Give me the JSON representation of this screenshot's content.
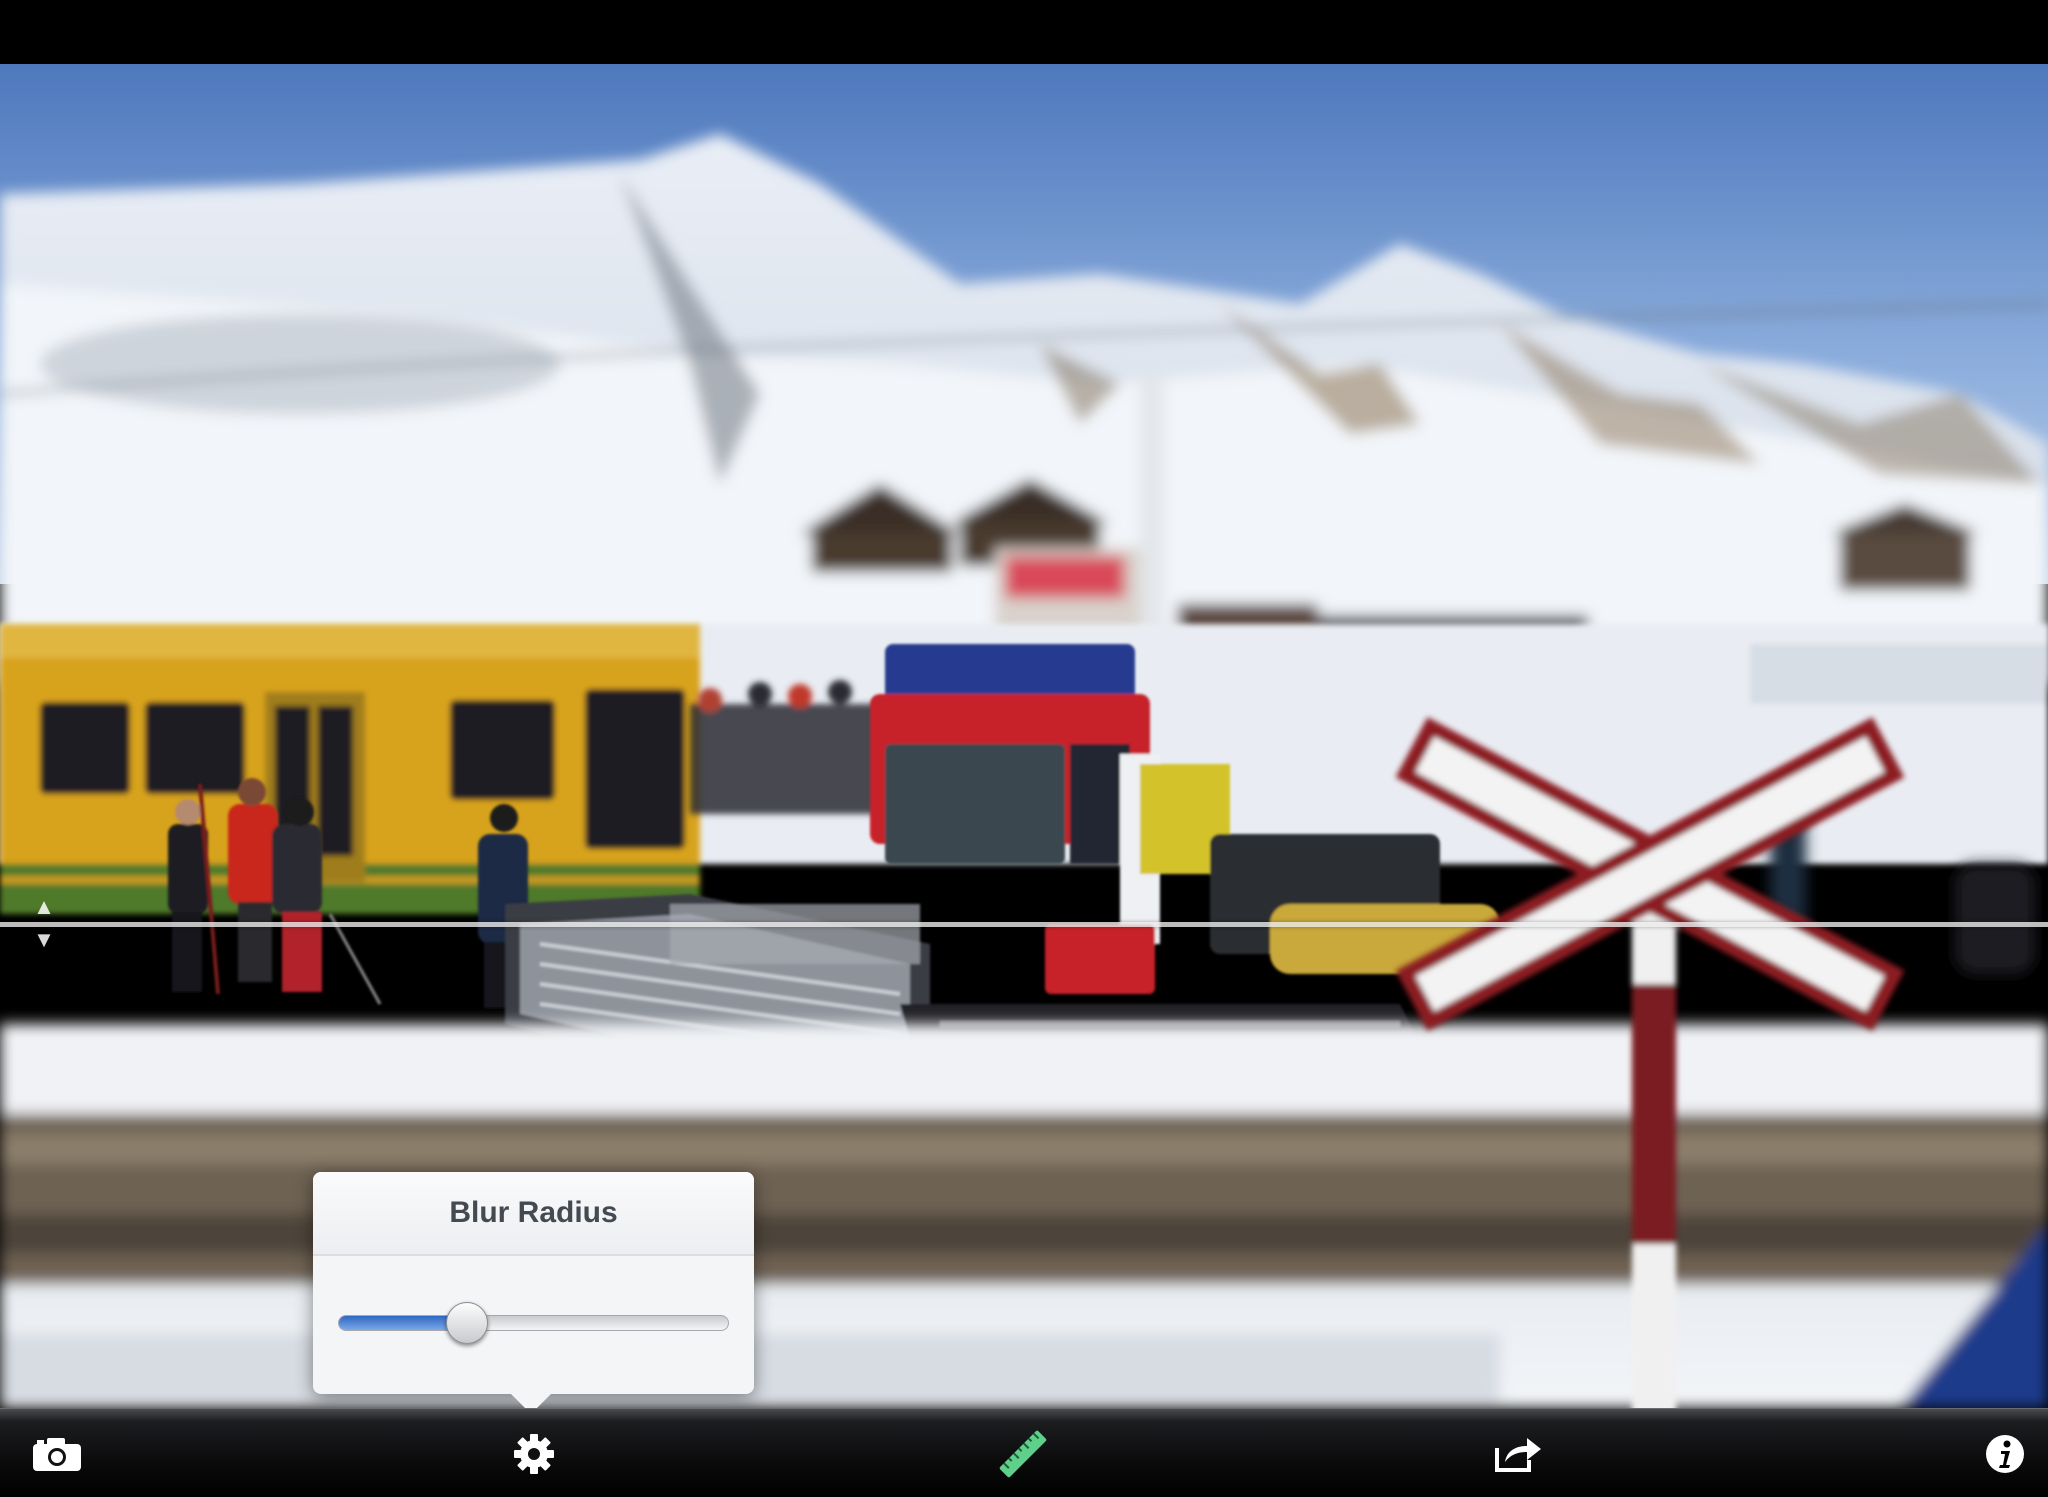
{
  "popover": {
    "title": "Blur Radius",
    "slider_value": 0.33
  },
  "icons": {
    "camera": "camera-icon",
    "settings": "gear-icon",
    "ruler": "ruler-icon",
    "share": "share-icon",
    "info": "info-icon",
    "handle_up": "arrow-up-icon",
    "handle_down": "arrow-down-icon"
  },
  "colors": {
    "slider_fill": "#3b78d8",
    "ruler_accent": "#5ed08a",
    "toolbar_bg": "#0b0b0c"
  }
}
